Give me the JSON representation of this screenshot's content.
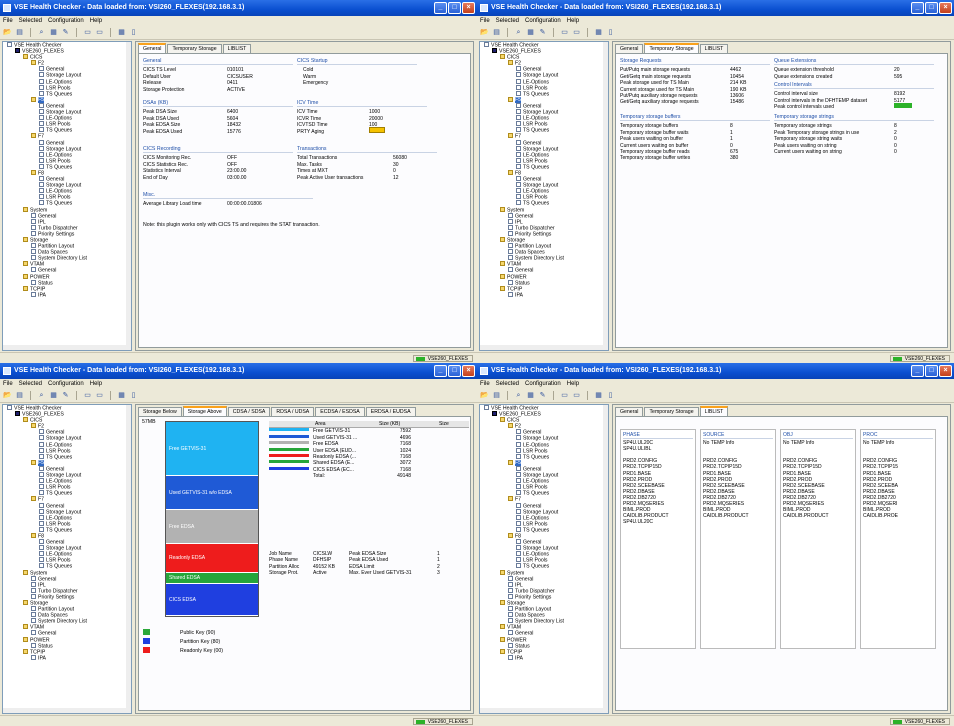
{
  "windows": [
    {
      "title": "VSE Health Checker - Data loaded from: VSI260_FLEXES(192.168.3.1)",
      "menu": [
        "File",
        "Selected",
        "Configuration",
        "Help"
      ],
      "status": "VSE260_FLEXES",
      "tabs": [
        {
          "label": "General",
          "active": true
        },
        {
          "label": "Temporary Storage",
          "active": false
        },
        {
          "label": "LIBLIST",
          "active": false
        }
      ],
      "tree_selected": 9,
      "general": {
        "general_head": "General",
        "general_rows": [
          [
            "CICS TS Level",
            "010101"
          ],
          [
            "Default User",
            "CICSUSER"
          ],
          [
            "Release",
            "0411"
          ],
          [
            "Storage Protection",
            "ACTIVE"
          ]
        ],
        "startup_head": "CICS Startup",
        "startup_rows": [
          "Cold",
          "Warm",
          "Emergency"
        ],
        "dsa_head": "DSAs (KB)",
        "dsa_rows": [
          [
            "Peak DSA Size",
            "6400"
          ],
          [
            "Peak DSA Used",
            "5604"
          ],
          [
            "Peak EDSA Size",
            "18432"
          ],
          [
            "Peak EDSA Used",
            "15776"
          ]
        ],
        "icv_head": "ICV Time",
        "icv_rows": [
          [
            "ICV Time",
            "1000"
          ],
          [
            "ICVR Time",
            "20000"
          ],
          [
            "ICVTSD Time",
            "100"
          ],
          [
            "PRTY Aging",
            ""
          ]
        ],
        "rec_head": "CICS Recording",
        "rec_rows": [
          [
            "CICS Monitoring Rec.",
            "OFF"
          ],
          [
            "CICS Statistics Rec.",
            "OFF"
          ],
          [
            "Statistics Interval",
            "23:00.00"
          ],
          [
            "End of Day",
            "03:00.00"
          ]
        ],
        "tr_head": "Transactions",
        "tr_rows": [
          [
            "Total Transactions",
            "56080"
          ],
          [
            "Max. Tasks",
            "30"
          ],
          [
            "Times at MXT",
            "0"
          ],
          [
            "Peak Active User transactions",
            "12"
          ]
        ],
        "misc_head": "Misc.",
        "misc_rows": [
          [
            "Average Library Load time",
            "00:00:00.01806"
          ]
        ],
        "note": "Note: this plugin works only with CICS TS and requires the STAT transaction."
      }
    },
    {
      "title": "VSE Health Checker - Data loaded from: VSI260_FLEXES(192.168.3.1)",
      "menu": [
        "File",
        "Selected",
        "Configuration",
        "Help"
      ],
      "status": "VSE260_FLEXES",
      "tabs": [
        {
          "label": "General",
          "active": false
        },
        {
          "label": "Temporary Storage",
          "active": true
        },
        {
          "label": "LIBLIST",
          "active": false
        }
      ],
      "tree_selected": 9,
      "ts": {
        "req_head": "Storage Requests",
        "req_rows": [
          [
            "Put/Putq main storage requests",
            "4462"
          ],
          [
            "Get/Getq main storage requests",
            "10454"
          ],
          [
            "Peak storage used for TS Main",
            "214 KB"
          ],
          [
            "Current storage used for TS Main",
            "190 KB"
          ],
          [
            "Put/Putq auxiliary storage requests",
            "13606"
          ],
          [
            "Get/Getq auxiliary storage requests",
            "15486"
          ]
        ],
        "qe_head": "Queue Extensions",
        "qe_rows": [
          [
            "Queue extension threshold",
            "20"
          ],
          [
            "Queue extensions created",
            "595"
          ]
        ],
        "ci_head": "Control Intervals",
        "ci_rows": [
          [
            "Control interval size",
            "8192"
          ],
          [
            "Control intervals in the DFHTEMP dataset",
            "5177"
          ],
          [
            "Peak control intervals used",
            ""
          ]
        ],
        "buf_head": "Temporary storage buffers",
        "buf_rows": [
          [
            "Temporary storage buffers",
            "8"
          ],
          [
            "Temporary storage buffer waits",
            "1"
          ],
          [
            "Peak users waiting on buffer",
            "1"
          ],
          [
            "Current users waiting on buffer",
            "0"
          ],
          [
            "Temporary storage buffer reads",
            "675"
          ],
          [
            "Temporary storage buffer writes",
            "380"
          ]
        ],
        "str_head": "Temporary storage strings",
        "str_rows": [
          [
            "Temporary storage strings",
            "8"
          ],
          [
            "Peak Temporary storage strings in use",
            "2"
          ],
          [
            "Temporary storage string waits",
            "0"
          ],
          [
            "Peak users waiting on string",
            "0"
          ],
          [
            "Current users waiting on string",
            "0"
          ]
        ]
      }
    },
    {
      "title": "VSE Health Checker - Data loaded from: VSI260_FLEXES(192.168.3.1)",
      "menu": [
        "File",
        "Selected",
        "Configuration",
        "Help"
      ],
      "status": "VSE260_FLEXES",
      "tabs": [
        {
          "label": "Storage Below",
          "active": false
        },
        {
          "label": "Storage Above",
          "active": true
        },
        {
          "label": "CDSA / SDSA",
          "active": false
        },
        {
          "label": "RDSA / UDSA",
          "active": false
        },
        {
          "label": "ECDSA / ESDSA",
          "active": false
        },
        {
          "label": "ERDSA / EUDSA",
          "active": false
        }
      ],
      "tree_selected": 9,
      "storage": {
        "axis_label": "57MB",
        "blocks": [
          {
            "label": "Free GETVIS-31",
            "size": 7592,
            "color": "#1fb3f2"
          },
          {
            "label": "Used GETVIS-31 w/o EDSA",
            "size": 4696,
            "color": "#1f5ad6"
          },
          {
            "label": "Free EDSA",
            "size": 4800,
            "color": "#b2b2b2"
          },
          {
            "label": "Readonly EDSA",
            "size": 4100,
            "color": "#ee1c1c"
          },
          {
            "label": "Shared EDSA",
            "size": 1500,
            "color": "#26a53a"
          },
          {
            "label": "CICS EDSA",
            "size": 4500,
            "color": "#1f3fe0"
          }
        ],
        "table_head": [
          "Area",
          "Size (KB)",
          "Size"
        ],
        "table_rows": [
          {
            "area": "Free GETVIS-31",
            "size": "7592",
            "color": "#1fb3f2"
          },
          {
            "area": "Used GETVIS-31 ...",
            "size": "4696",
            "color": "#1f5ad6"
          },
          {
            "area": "Free EDSA",
            "size": "7168",
            "color": "#b2b2b2"
          },
          {
            "area": "User EDSA (EUD...",
            "size": "1024",
            "color": "#26a53a"
          },
          {
            "area": "Readonly EDSA (...",
            "size": "7168",
            "color": "#ee1c1c"
          },
          {
            "area": "Shared EDSA (E...",
            "size": "3072",
            "color": "#26a53a"
          },
          {
            "area": "CICS EDSA (EC...",
            "size": "7168",
            "color": "#1f3fe0"
          },
          {
            "area": "Total:",
            "size": "49148",
            "color": ""
          }
        ],
        "info_rows": [
          [
            "Job Name",
            "CICSLW",
            "Peak EDSA Size",
            "1"
          ],
          [
            "Phase Name",
            "DFHSIP",
            "Peak EDSA Used",
            "1"
          ],
          [
            "Partition Alloc",
            "49152 KB",
            "EDSA Limit",
            "2"
          ],
          [
            "Storage Prot.",
            "Active",
            "Max. Ever Used GETVIS-31",
            "3"
          ]
        ],
        "legend": [
          {
            "label": "Public Key (90)",
            "color": "#2ba83a"
          },
          {
            "label": "Partition Key (80)",
            "color": "#1f3fe0"
          },
          {
            "label": "Readonly Key (00)",
            "color": "#ee1c1c"
          }
        ]
      }
    },
    {
      "title": "VSE Health Checker - Data loaded from: VSI260_FLEXES(192.168.3.1)",
      "menu": [
        "File",
        "Selected",
        "Configuration",
        "Help"
      ],
      "status": "VSE260_FLEXES",
      "tabs": [
        {
          "label": "General",
          "active": false
        },
        {
          "label": "Temporary Storage",
          "active": false
        },
        {
          "label": "LIBLIST",
          "active": true
        }
      ],
      "tree_selected": 9,
      "liblist": {
        "columns": [
          {
            "head": "PHASE",
            "items": [
              "SP4U.UL20C",
              "SP4U.ULIBL",
              "",
              "PRD2.CONFIG",
              "PRD2.TCPIP15D",
              "PRD1.BASE",
              "PRD2.PROD",
              "PRD2.SCEEBASE",
              "PRD2.DBASE",
              "PRD2.DB2720",
              "PRD2.MQSERIES",
              "BIML.PROD",
              "CAIDLIB.PRODUCT",
              "SP4U.UL20C"
            ]
          },
          {
            "head": "SOURCE",
            "items": [
              "No TEMP Info",
              "",
              "",
              "PRD2.CONFIG",
              "PRD2.TCPIP15D",
              "PRD1.BASE",
              "PRD2.PROD",
              "PRD2.SCEEBASE",
              "PRD2.DBASE",
              "PRD2.DB2720",
              "PRD2.MQSERIES",
              "BIML.PROD",
              "CAIDLIB.PRODUCT"
            ]
          },
          {
            "head": "OBJ",
            "items": [
              "No TEMP Info",
              "",
              "",
              "PRD2.CONFIG",
              "PRD2.TCPIP15D",
              "PRD1.BASE",
              "PRD2.PROD",
              "PRD2.SCEEBASE",
              "PRD2.DBASE",
              "PRD2.DB2720",
              "PRD2.MQSERIES",
              "BIML.PROD",
              "CAIDLIB.PRODUCT"
            ]
          },
          {
            "head": "PROC",
            "items": [
              "No TEMP Info",
              "",
              "",
              "PRD2.CONFIG",
              "PRD2.TCPIP15",
              "PRD1.BASE",
              "PRD2.PROD",
              "PRD2.SCEEBA",
              "PRD2.DBASE",
              "PRD2.DB2720",
              "PRD2.MQSERI",
              "BIML.PROD",
              "CAIDLIB.PROE"
            ]
          }
        ]
      }
    }
  ],
  "tree": [
    {
      "label": "VSE Health Checker",
      "depth": 0,
      "type": "doc"
    },
    {
      "label": "VSE260_FLEXES",
      "depth": 1,
      "type": "srv"
    },
    {
      "label": "CICS",
      "depth": 2,
      "type": "folder"
    },
    {
      "label": "F2",
      "depth": 3,
      "type": "folder"
    },
    {
      "label": "General",
      "depth": 4,
      "type": "doc"
    },
    {
      "label": "Storage Layout",
      "depth": 4,
      "type": "doc"
    },
    {
      "label": "LE-Options",
      "depth": 4,
      "type": "doc"
    },
    {
      "label": "LSR Pools",
      "depth": 4,
      "type": "doc"
    },
    {
      "label": "TS Queues",
      "depth": 4,
      "type": "doc"
    },
    {
      "label": "F5",
      "depth": 3,
      "type": "folder"
    },
    {
      "label": "General",
      "depth": 4,
      "type": "doc"
    },
    {
      "label": "Storage Layout",
      "depth": 4,
      "type": "doc"
    },
    {
      "label": "LE-Options",
      "depth": 4,
      "type": "doc"
    },
    {
      "label": "LSR Pools",
      "depth": 4,
      "type": "doc"
    },
    {
      "label": "TS Queues",
      "depth": 4,
      "type": "doc"
    },
    {
      "label": "F7",
      "depth": 3,
      "type": "folder"
    },
    {
      "label": "General",
      "depth": 4,
      "type": "doc"
    },
    {
      "label": "Storage Layout",
      "depth": 4,
      "type": "doc"
    },
    {
      "label": "LE-Options",
      "depth": 4,
      "type": "doc"
    },
    {
      "label": "LSR Pools",
      "depth": 4,
      "type": "doc"
    },
    {
      "label": "TS Queues",
      "depth": 4,
      "type": "doc"
    },
    {
      "label": "F8",
      "depth": 3,
      "type": "folder"
    },
    {
      "label": "General",
      "depth": 4,
      "type": "doc"
    },
    {
      "label": "Storage Layout",
      "depth": 4,
      "type": "doc"
    },
    {
      "label": "LE-Options",
      "depth": 4,
      "type": "doc"
    },
    {
      "label": "LSR Pools",
      "depth": 4,
      "type": "doc"
    },
    {
      "label": "TS Queues",
      "depth": 4,
      "type": "doc"
    },
    {
      "label": "System",
      "depth": 2,
      "type": "folder"
    },
    {
      "label": "General",
      "depth": 3,
      "type": "doc"
    },
    {
      "label": "IPL",
      "depth": 3,
      "type": "doc"
    },
    {
      "label": "Turbo Dispatcher",
      "depth": 3,
      "type": "doc"
    },
    {
      "label": "Priority Settings",
      "depth": 3,
      "type": "doc"
    },
    {
      "label": "Storage",
      "depth": 2,
      "type": "folder"
    },
    {
      "label": "Partition Layout",
      "depth": 3,
      "type": "doc"
    },
    {
      "label": "Data Spaces",
      "depth": 3,
      "type": "doc"
    },
    {
      "label": "System Directory List",
      "depth": 3,
      "type": "doc"
    },
    {
      "label": "VTAM",
      "depth": 2,
      "type": "folder"
    },
    {
      "label": "General",
      "depth": 3,
      "type": "doc"
    },
    {
      "label": "POWER",
      "depth": 2,
      "type": "folder"
    },
    {
      "label": "Status",
      "depth": 3,
      "type": "doc"
    },
    {
      "label": "TCPIP",
      "depth": 2,
      "type": "folder"
    },
    {
      "label": "IPA",
      "depth": 3,
      "type": "doc"
    }
  ]
}
